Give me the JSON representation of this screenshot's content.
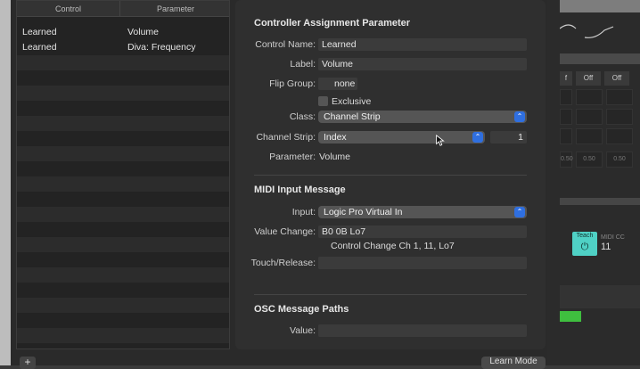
{
  "table": {
    "headers": [
      "Control",
      "Parameter"
    ],
    "rows": [
      {
        "control": "Learned",
        "parameter": "Volume"
      },
      {
        "control": "Learned",
        "parameter": "Diva: Frequency"
      }
    ]
  },
  "assignment": {
    "section_title": "Controller Assignment Parameter",
    "control_name_label": "Control Name:",
    "control_name_value": "Learned",
    "label_label": "Label:",
    "label_value": "Volume",
    "flip_group_label": "Flip Group:",
    "flip_group_value": "none",
    "exclusive_label": "Exclusive",
    "class_label": "Class:",
    "class_value": "Channel Strip",
    "channel_strip_label": "Channel Strip:",
    "channel_strip_value": "Index",
    "channel_strip_number": "1",
    "parameter_label": "Parameter:",
    "parameter_value": "Volume"
  },
  "midi": {
    "section_title": "MIDI Input Message",
    "input_label": "Input:",
    "input_value": "Logic Pro Virtual In",
    "value_change_label": "Value Change:",
    "value_change_value": "B0 0B Lo7",
    "value_change_desc": "Control Change Ch 1, 11, Lo7",
    "touch_release_label": "Touch/Release:",
    "touch_release_value": ""
  },
  "osc": {
    "section_title": "OSC Message Paths",
    "value_label": "Value:",
    "value_value": ""
  },
  "background": {
    "off_labels": [
      "f",
      "Off",
      "Off"
    ],
    "teach_label": "Teach",
    "midi_cc_label": "MIDI CC",
    "midi_cc_value": "11",
    "grid_values": [
      "0.50",
      "0.50",
      "0.50"
    ]
  },
  "footer": {
    "add_label": "+",
    "learn_mode_label": "Learn Mode"
  },
  "colors": {
    "accent_blue": "#2f6fe0",
    "teach_teal": "#4fd1c5",
    "meter_green": "#3fbf3f"
  }
}
